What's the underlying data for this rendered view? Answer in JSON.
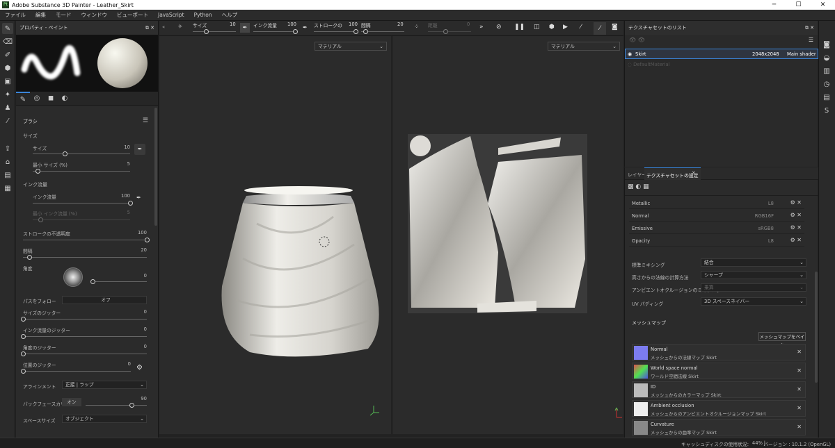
{
  "window": {
    "title": "Adobe Substance 3D Painter - Leather_Skirt",
    "logo": "Pt",
    "min": "─",
    "max": "☐",
    "close": "✕"
  },
  "menu": [
    "ファイル",
    "編集",
    "モード",
    "ウィンドウ",
    "ビューポート",
    "JavaScript",
    "Python",
    "ヘルプ"
  ],
  "props": {
    "title": "プロパティ - ペイント",
    "section": "ブラシ",
    "size_group": "サイズ",
    "size": {
      "label": "サイズ",
      "value": "10",
      "fraction": 0.33
    },
    "min_size": {
      "label": "最小 サイズ (%)",
      "value": "5",
      "fraction": 0.05
    },
    "flow_group": "インク流量",
    "flow": {
      "label": "インク流量",
      "value": "100",
      "fraction": 1.0
    },
    "min_flow": {
      "label": "最小 インク流量 (%)",
      "value": "5"
    },
    "opacity": {
      "label": "ストロークの不透明度",
      "value": "100",
      "fraction": 1.0
    },
    "spacing": {
      "label": "間隔",
      "value": "20",
      "fraction": 0.05
    },
    "angle": {
      "label": "角度",
      "value": "0",
      "fraction": 0.0
    },
    "follow": {
      "label": "パスをフォロー",
      "value": "オフ"
    },
    "size_jitter": {
      "label": "サイズのジッター",
      "value": "0"
    },
    "flow_jitter": {
      "label": "インク流量のジッター",
      "value": "0"
    },
    "angle_jitter": {
      "label": "角度のジッター",
      "value": "0"
    },
    "pos_jitter": {
      "label": "位置のジッター",
      "value": "0"
    },
    "alignment": {
      "label": "アラインメント",
      "value": "正接 | ラップ"
    },
    "backface": {
      "label": "バックフェースカリング",
      "toggle": "オン",
      "value": "90",
      "fraction": 0.75
    },
    "space": {
      "label": "スペースサイズ",
      "value": "オブジェクト"
    }
  },
  "toolbar": {
    "size_label": "サイズ",
    "size_value": "10",
    "flow_label": "インク流量",
    "flow_value": "100",
    "stroke_label": "ストロークの",
    "stroke_value": "100",
    "spacing_label": "間隔",
    "spacing_value": "20",
    "spread_label": "距離",
    "spread_value": "0"
  },
  "viewport": {
    "left_material": "マテリアル",
    "right_material": "マテリアル"
  },
  "texlist": {
    "title": "テクスチャセットのリスト",
    "items": [
      {
        "name": "Skirt",
        "res": "2048x2048",
        "shader": "Main shader"
      },
      {
        "name": "DefaultMaterial"
      }
    ]
  },
  "texset": {
    "tab_layers": "レイヤー",
    "tab_settings": "テクスチャセットの設定",
    "channels": [
      {
        "name": "Metallic",
        "format": "L8"
      },
      {
        "name": "Normal",
        "format": "RGB16F"
      },
      {
        "name": "Emissive",
        "format": "sRGB8"
      },
      {
        "name": "Opacity",
        "format": "L8"
      }
    ],
    "settings": [
      {
        "label": "標準ミキシング",
        "value": "結合"
      },
      {
        "label": "高さからの法線の計算方法",
        "value": "シャープ"
      },
      {
        "label": "アンビエントオクルージョンのミキシング",
        "value": "乗算"
      },
      {
        "label": "UV パディング",
        "value": "3D スペースネイバー"
      }
    ],
    "meshmap_title": "メッシュマップ",
    "bake_button": "メッシュマップをベイク",
    "maps": [
      {
        "name": "Normal",
        "desc": "メッシュからの法線マップ Skirt",
        "color": "#7c7cf0"
      },
      {
        "name": "World space normal",
        "desc": "ワールド空間法線 Skirt",
        "color": "#e07050"
      },
      {
        "name": "ID",
        "desc": "メッシュからのカラーマップ Skirt",
        "color": "#bbbbbb"
      },
      {
        "name": "Ambient occlusion",
        "desc": "メッシュからのアンビエントオクルージョンマップ Skirt",
        "color": "#eeeeee"
      },
      {
        "name": "Curvature",
        "desc": "メッシュからの曲率マップ Skirt",
        "color": "#888888"
      }
    ]
  },
  "status": {
    "cache_label": "キャッシュディスクの使用状況:",
    "cache_value": "44%",
    "version": "バージョン : 10.1.2 (OpenGL)"
  }
}
